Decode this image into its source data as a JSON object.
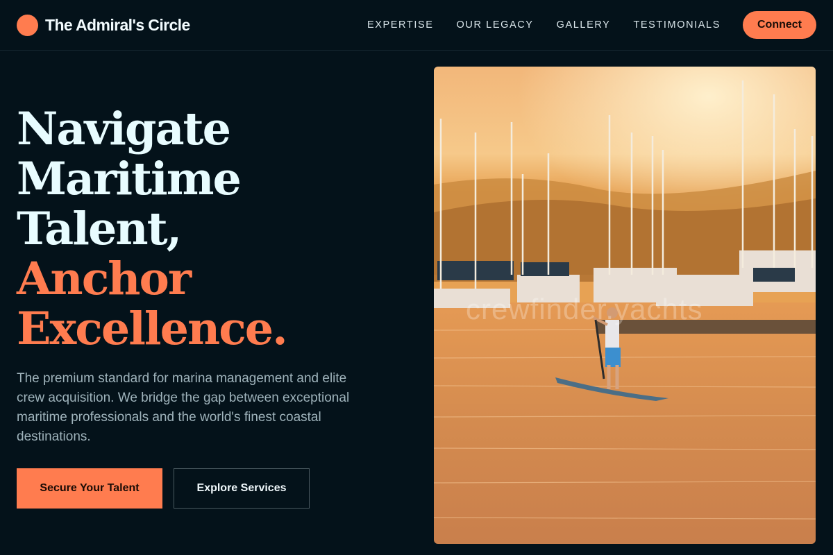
{
  "brand": {
    "name": "The Admiral's Circle"
  },
  "nav": {
    "links": [
      "EXPERTISE",
      "OUR LEGACY",
      "GALLERY",
      "TESTIMONIALS"
    ],
    "connect_label": "Connect"
  },
  "hero": {
    "title_lines": [
      "Navigate",
      "Maritime",
      "Talent,"
    ],
    "accent_lines": [
      "Anchor",
      "Excellence."
    ],
    "description": "The premium standard for marina management and elite crew acquisition. We bridge the gap between exceptional maritime professionals and the world's finest coastal destinations.",
    "primary_cta": "Secure Your Talent",
    "secondary_cta": "Explore Services"
  },
  "image": {
    "subject": "paddleboarder at sunset marina with sailboats",
    "watermark": "crewfinder.yachts"
  },
  "colors": {
    "background": "#04121a",
    "accent": "#ff7c4f",
    "heading": "#e8fcff",
    "body_text": "#9fb3bb"
  }
}
